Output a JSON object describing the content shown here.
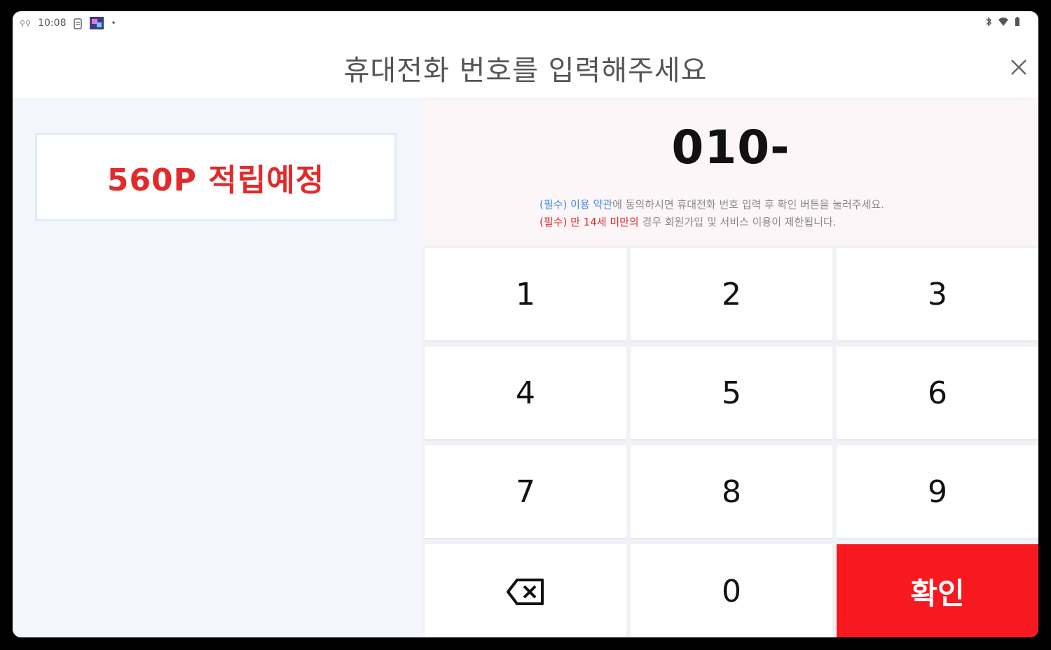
{
  "statusbar": {
    "time": "10:08"
  },
  "header": {
    "title": "휴대전화 번호를 입력해주세요"
  },
  "points": {
    "text": "560P 적립예정"
  },
  "input": {
    "value": "010-"
  },
  "notice": {
    "line1": {
      "prefix": "(필수)",
      "terms": "이용 약관",
      "rest": "에 동의하시면 휴대전화 번호 입력 후 확인 버튼을 눌러주세요."
    },
    "line2": {
      "prefix": "(필수) 만",
      "age": "14세",
      "under": "미만의",
      "rest": "경우 회원가입 및 서비스 이용이 제한됩니다."
    }
  },
  "keypad": {
    "k1": "1",
    "k2": "2",
    "k3": "3",
    "k4": "4",
    "k5": "5",
    "k6": "6",
    "k7": "7",
    "k8": "8",
    "k9": "9",
    "k0": "0",
    "backspace_icon": "backspace-icon",
    "confirm": "확인"
  },
  "colors": {
    "accent_red": "#f7191f",
    "points_red": "#e12b2b",
    "link_blue": "#3f8ee2"
  }
}
